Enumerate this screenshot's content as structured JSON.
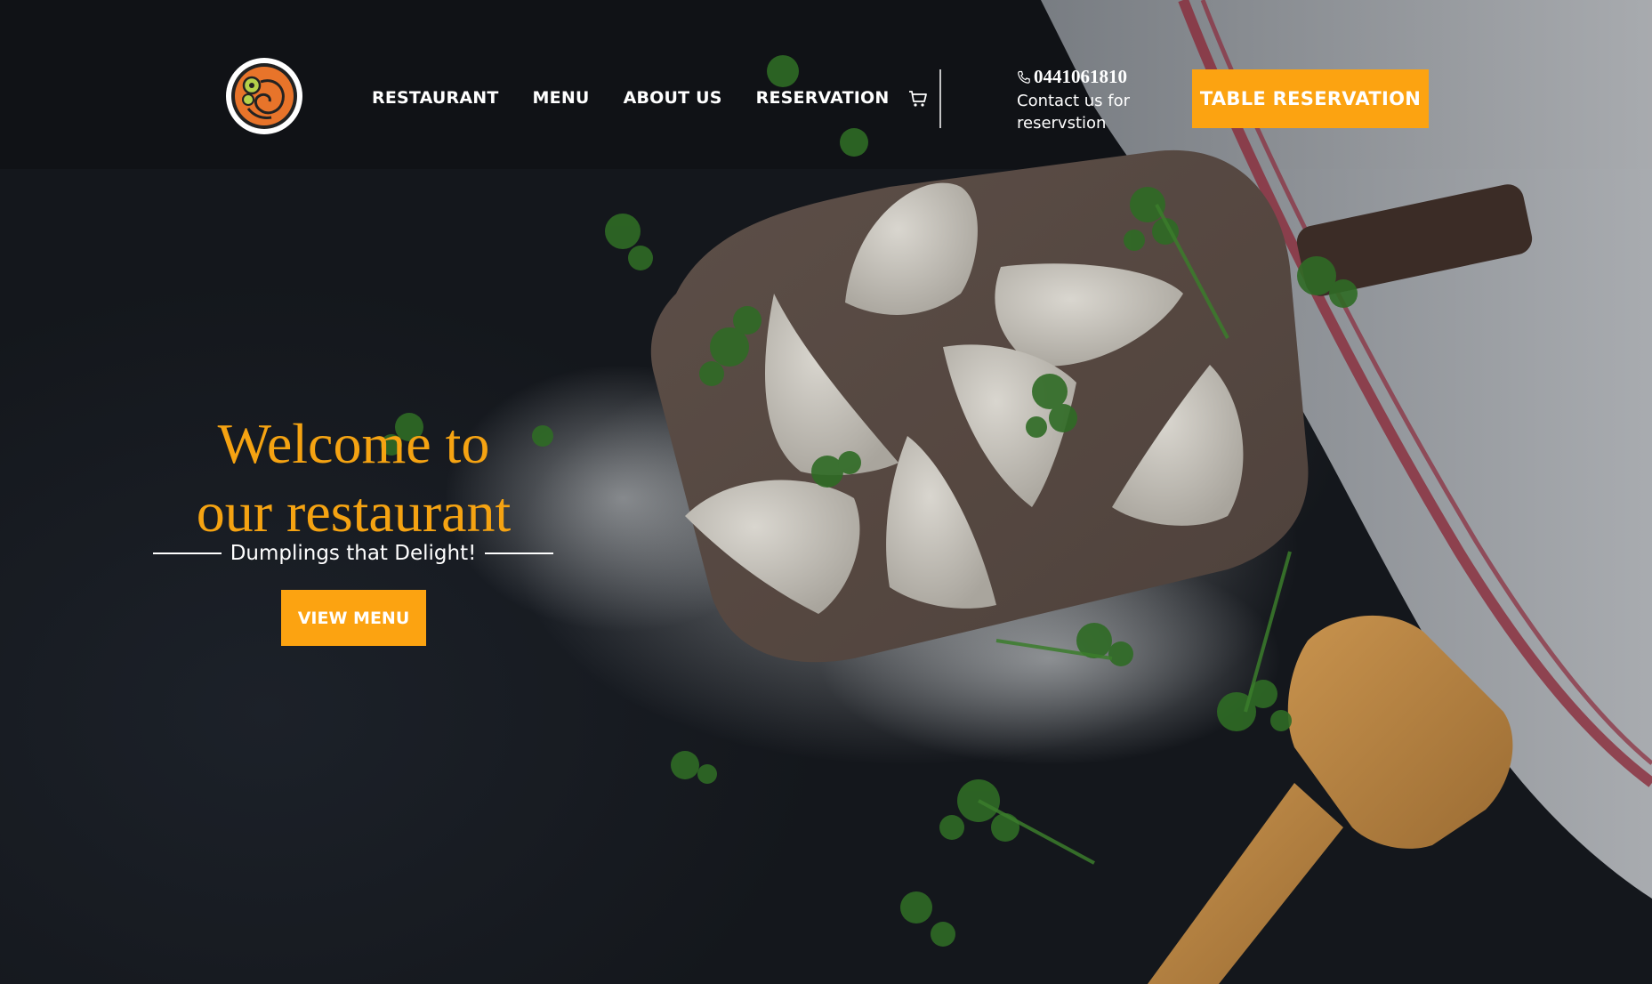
{
  "brand": {
    "logo_icon": "dumpling-plate-logo-icon"
  },
  "nav": {
    "items": [
      {
        "label": "RESTAURANT"
      },
      {
        "label": "MENU"
      },
      {
        "label": "ABOUT US"
      },
      {
        "label": "RESERVATION"
      }
    ],
    "cart_icon": "cart-icon"
  },
  "contact": {
    "phone_icon": "phone-icon",
    "phone": "0441061810",
    "note": "Contact us for reservstion"
  },
  "header_cta": {
    "label": "TABLE RESERVATION"
  },
  "hero": {
    "title_line1": "Welcome to",
    "title_line2": "our restaurant",
    "tagline": "Dumplings that Delight!",
    "cta_label": "VIEW MENU"
  },
  "colors": {
    "accent": "#fca311",
    "heading": "#f5a312",
    "background": "#161a20",
    "text": "#ffffff"
  }
}
